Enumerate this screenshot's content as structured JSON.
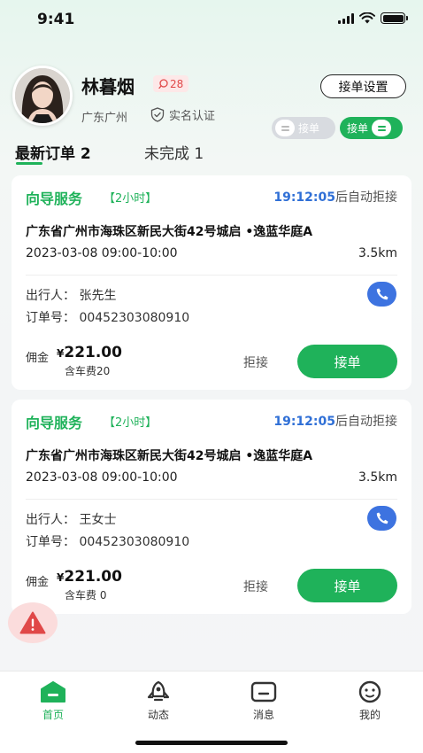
{
  "status_bar": {
    "time": "9:41"
  },
  "profile": {
    "name": "林暮烟",
    "badge_count": "28",
    "location": "广东广州",
    "verified_label": "实名认证",
    "settings_button": "接单设置",
    "toggle_off_label": "接单",
    "toggle_on_label": "接单"
  },
  "tabs": [
    {
      "label": "最新订单 2"
    },
    {
      "label": "未完成 1"
    }
  ],
  "orders": [
    {
      "service": "向导服务",
      "duration": "【2小时】",
      "countdown_time": "19:12:05",
      "countdown_suffix": "后自动拒接",
      "address": "广东省广州市海珠区新民大街42号城启 •逸蓝华庭A",
      "datetime": "2023-03-08  09:00-10:00",
      "distance": "3.5km",
      "traveler": "出行人：  张先生",
      "order_no": "订单号：  00452303080910",
      "commission_label": "佣金",
      "currency": "¥",
      "price": "221.00",
      "car_fee": "含车费20",
      "reject_label": "拒接",
      "accept_label": "接单"
    },
    {
      "service": "向导服务",
      "duration": "【2小时】",
      "countdown_time": "19:12:05",
      "countdown_suffix": "后自动拒接",
      "address": "广东省广州市海珠区新民大街42号城启 •逸蓝华庭A",
      "datetime": "2023-03-08  09:00-10:00",
      "distance": "3.5km",
      "traveler": "出行人：  王女士",
      "order_no": "订单号：  00452303080910",
      "commission_label": "佣金",
      "currency": "¥",
      "price": "221.00",
      "car_fee": "含车费 0",
      "reject_label": "拒接",
      "accept_label": "接单"
    }
  ],
  "bottom_nav": [
    {
      "label": "首页",
      "icon": "home-icon",
      "active": true
    },
    {
      "label": "动态",
      "icon": "rocket-icon",
      "active": false
    },
    {
      "label": "消息",
      "icon": "message-icon",
      "active": false
    },
    {
      "label": "我的",
      "icon": "smiley-icon",
      "active": false
    }
  ],
  "colors": {
    "accent": "#1fb25a",
    "countdown_blue": "#2f6fd6",
    "phone_blue": "#3d73e0",
    "warning_red": "#e04848"
  }
}
